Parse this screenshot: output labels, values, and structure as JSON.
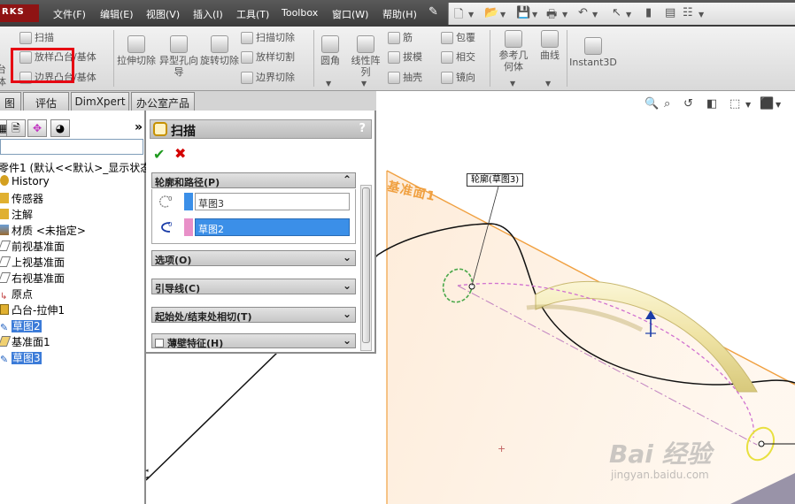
{
  "app": {
    "logo_text": "RKS"
  },
  "menu": {
    "items": [
      "文件(F)",
      "编辑(E)",
      "视图(V)",
      "插入(I)",
      "工具(T)",
      "Toolbox",
      "窗口(W)",
      "帮助(H)"
    ]
  },
  "ribbon": {
    "sweep": "扫描",
    "loft_boss": "放样凸台/基体",
    "boundary_boss": "边界凸台/基体",
    "boss_partial": "台",
    "body_partial": "体",
    "extruded_cut": "拉伸切除",
    "hole_wizard": "异型孔向导",
    "revolved_cut": "旋转切除",
    "swept_cut": "扫描切除",
    "lofted_cut": "放样切割",
    "boundary_cut": "边界切除",
    "fillet": "圆角",
    "linear_pattern": "线性阵列",
    "rib": "筋",
    "draft": "拔模",
    "shell": "抽壳",
    "wrap": "包覆",
    "intersect": "相交",
    "mirror": "镜向",
    "reference_geometry": "参考几何体",
    "curves": "曲线",
    "instant3d": "Instant3D"
  },
  "tabs": [
    "图",
    "评估",
    "DimXpert",
    "办公室产品"
  ],
  "tree": {
    "title": "零件1 (默认<<默认>_显示状态",
    "items": [
      {
        "label": "History",
        "color": "#b58a2a"
      },
      {
        "label": "传感器",
        "color": "#d4a020"
      },
      {
        "label": "注解",
        "color": "#d4a020"
      },
      {
        "label": "材质 <未指定>",
        "color": "#4a7fc0"
      },
      {
        "label": "前视基准面",
        "color": "#888888"
      },
      {
        "label": "上视基准面",
        "color": "#888888"
      },
      {
        "label": "右视基准面",
        "color": "#888888"
      },
      {
        "label": "原点",
        "color": "#c04040"
      },
      {
        "label": "凸台-拉伸1",
        "color": "#d4a020"
      },
      {
        "label": "草图2",
        "color": "#2060c0"
      },
      {
        "label": "基准面1",
        "color": "#888888"
      },
      {
        "label": "草图3",
        "color": "#2060c0"
      }
    ]
  },
  "property_manager": {
    "title": "扫描",
    "help": "?",
    "ok": "✔",
    "cancel": "✖",
    "groups": {
      "profile_path": "轮廓和路径(P)",
      "options": "选项(O)",
      "guide_curves": "引导线(C)",
      "start_end_tangency": "起始处/结束处相切(T)",
      "thin_feature": "薄壁特征(H)"
    },
    "profile_value": "草图3",
    "path_value": "草图2"
  },
  "graphics": {
    "callout": "轮廓(草图3)",
    "plane_label": "基准面1",
    "watermark": "Bai 经验",
    "watermark_url": "jingyan.baidu.com"
  }
}
